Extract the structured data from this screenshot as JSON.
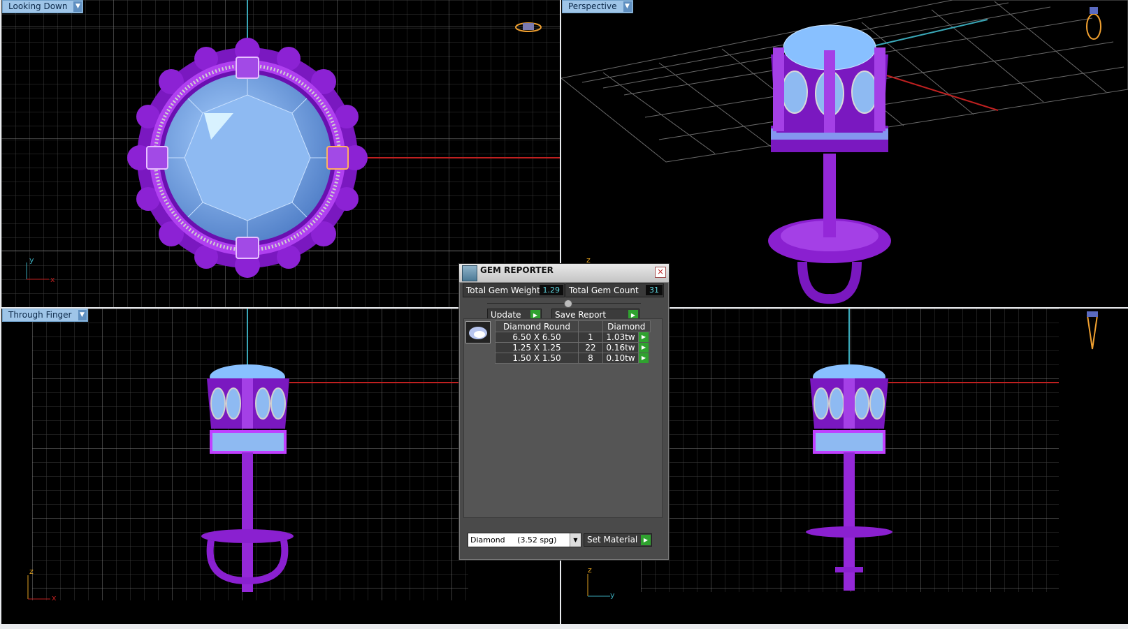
{
  "viewports": {
    "top_left": {
      "label": "Looking Down",
      "axis_v": "y",
      "axis_h": "x"
    },
    "top_right": {
      "label": "Perspective",
      "axis_v": "z"
    },
    "bottom_left": {
      "label": "Through Finger",
      "axis_v": "z",
      "axis_h": "x"
    },
    "bottom_right": {
      "axis_v": "z",
      "axis_h": "y"
    }
  },
  "gem_reporter": {
    "title": "GEM REPORTER",
    "total_weight_label": "Total Gem Weight",
    "total_weight_value": "1.29",
    "total_count_label": "Total Gem Count",
    "total_count_value": "31",
    "update_label": "Update",
    "save_report_label": "Save Report",
    "table_headers": [
      "Diamond Round",
      "",
      "Diamond"
    ],
    "rows": [
      {
        "size": "6.50 X 6.50",
        "count": "1",
        "weight": "1.03tw"
      },
      {
        "size": "1.25 X 1.25",
        "count": "22",
        "weight": "0.16tw"
      },
      {
        "size": "1.50 X 1.50",
        "count": "8",
        "weight": "0.10tw"
      }
    ],
    "material_select": "Diamond     (3.52 spg)",
    "set_material_label": "Set Material"
  },
  "colors": {
    "metal": "#9a2be0",
    "gem": "#7fb3f0",
    "grid": "#555555",
    "axis_red": "#c02020",
    "axis_cyan": "#3aa8b8"
  }
}
